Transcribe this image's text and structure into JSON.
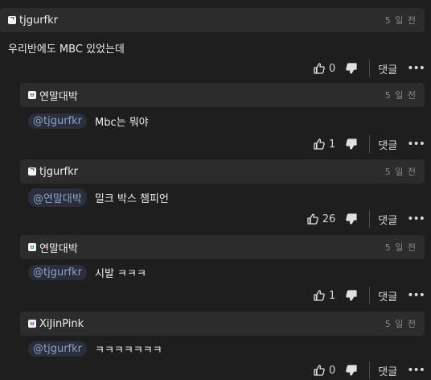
{
  "comments": [
    {
      "author": "tjgurfkr",
      "badge": "ᄀ",
      "time": "5 일 전",
      "mention": "",
      "text": "우리반에도 MBC 있었는데",
      "likes": "0"
    },
    {
      "author": "연말대박",
      "badge": "ㅂ",
      "time": "5 일 전",
      "mention": "@tjgurfkr",
      "text": "Mbc는 뭐야",
      "likes": "1"
    },
    {
      "author": "tjgurfkr",
      "badge": "ᄀ",
      "time": "5 일 전",
      "mention": "@연말대박",
      "text": "밀크 박스 챔피언",
      "likes": "26"
    },
    {
      "author": "연말대박",
      "badge": "ㅂ",
      "time": "5 일 전",
      "mention": "@tjgurfkr",
      "text": "시발 ㅋㅋㅋ",
      "likes": "1"
    },
    {
      "author": "XiJinPink",
      "badge": "ㅂ",
      "time": "5 일 전",
      "mention": "@tjgurfkr",
      "text": "ㅋㅋㅋㅋㅋㅋㅋ",
      "likes": "0"
    }
  ],
  "actions": {
    "reply_label": "댓글",
    "more_label": "•••"
  },
  "icons": {
    "like": "thumbs-up-icon",
    "dislike": "thumbs-down-icon",
    "more": "more-icon"
  }
}
